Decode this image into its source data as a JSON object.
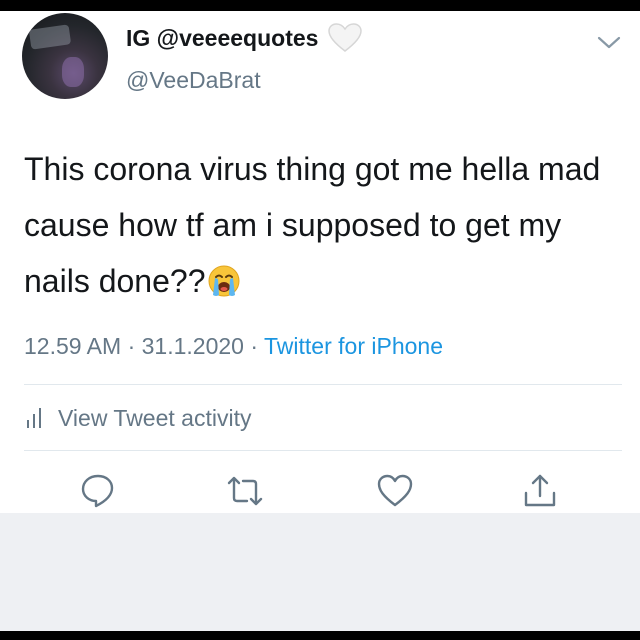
{
  "tweet": {
    "display_name": "IG @veeeequotes",
    "handle": "@VeeDaBrat",
    "text": "This corona virus thing got me hella mad cause how tf am i supposed to get my nails done??",
    "emoji": "loudly-crying-face",
    "time": "12.59 AM",
    "separator": "·",
    "date": "31.1.2020",
    "source": "Twitter for iPhone",
    "activity_label": "View Tweet activity"
  },
  "icons": {
    "badge": "white-heart-icon",
    "menu": "chevron-down-icon",
    "activity": "bar-chart-icon",
    "actions": [
      "reply-icon",
      "retweet-icon",
      "like-icon",
      "share-icon"
    ]
  },
  "colors": {
    "text": "#14171a",
    "secondary": "#657786",
    "link": "#1b95e0",
    "divider": "#e1e8ed",
    "footer_bg": "#eef0f3"
  }
}
